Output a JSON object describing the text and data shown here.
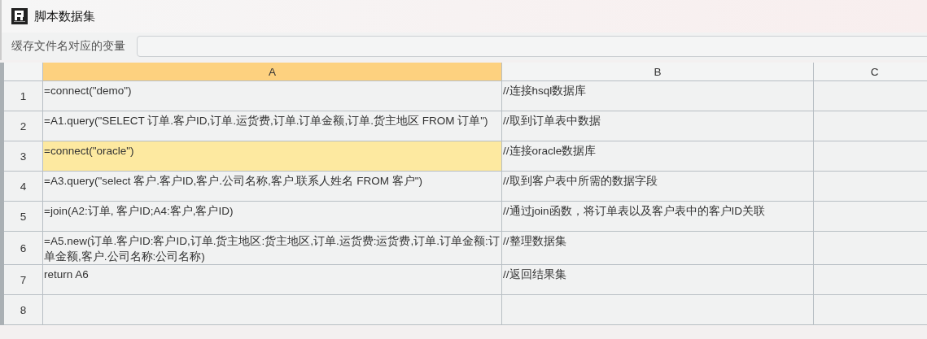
{
  "window": {
    "title": "脚本数据集"
  },
  "variable_field": {
    "label": "缓存文件名对应的变量"
  },
  "columns": [
    {
      "label": "A",
      "selected": true
    },
    {
      "label": "B",
      "selected": false
    },
    {
      "label": "C",
      "selected": false
    }
  ],
  "rows": [
    {
      "number": "1",
      "cells": [
        {
          "text": "=connect(\"demo\")",
          "selected": false
        },
        {
          "text": "//连接hsql数据库",
          "selected": false
        }
      ]
    },
    {
      "number": "2",
      "cells": [
        {
          "text": "=A1.query(\"SELECT 订单.客户ID,订单.运货费,订单.订单金额,订单.货主地区 FROM 订单\")",
          "selected": false
        },
        {
          "text": "//取到订单表中数据",
          "selected": false
        }
      ]
    },
    {
      "number": "3",
      "cells": [
        {
          "text": "=connect(\"oracle\")",
          "selected": true
        },
        {
          "text": "//连接oracle数据库",
          "selected": false
        }
      ]
    },
    {
      "number": "4",
      "cells": [
        {
          "text": "=A3.query(\"select  客户.客户ID,客户.公司名称,客户.联系人姓名 FROM 客户\")",
          "selected": false
        },
        {
          "text": "//取到客户表中所需的数据字段",
          "selected": false
        }
      ]
    },
    {
      "number": "5",
      "cells": [
        {
          "text": "=join(A2:订单, 客户ID;A4:客户,客户ID)",
          "selected": false
        },
        {
          "text": "//通过join函数，将订单表以及客户表中的客户ID关联",
          "selected": false
        }
      ]
    },
    {
      "number": "6",
      "cells": [
        {
          "text": "=A5.new(订单.客户ID:客户ID,订单.货主地区:货主地区,订单.运货费:运货费,订单.订单金额:订单金额,客户.公司名称:公司名称)",
          "selected": false
        },
        {
          "text": "//整理数据集",
          "selected": false
        }
      ]
    },
    {
      "number": "7",
      "cells": [
        {
          "text": "return A6",
          "selected": false
        },
        {
          "text": "//返回结果集",
          "selected": false
        }
      ]
    },
    {
      "number": "8"
    }
  ]
}
